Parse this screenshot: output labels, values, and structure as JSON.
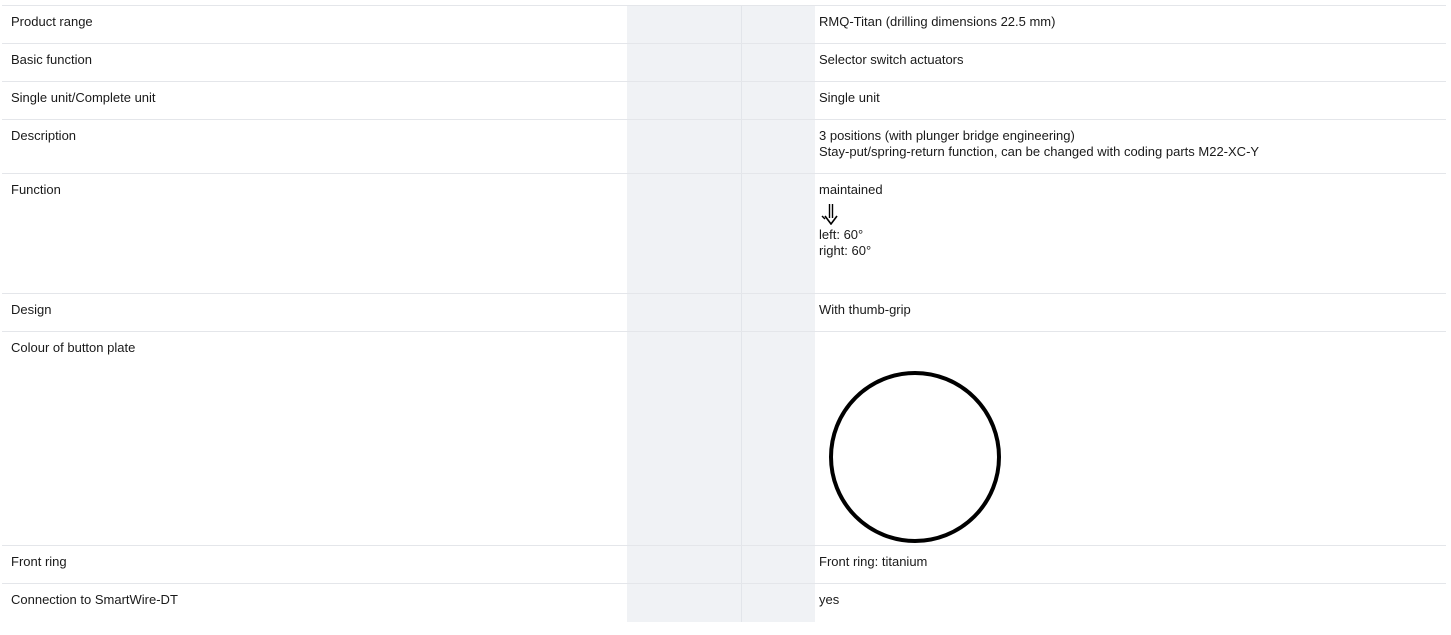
{
  "rows": [
    {
      "label": "Product range",
      "value": "RMQ-Titan (drilling dimensions 22.5 mm)"
    },
    {
      "label": "Basic function",
      "value": "Selector switch actuators"
    },
    {
      "label": "Single unit/Complete unit",
      "value": "Single unit"
    },
    {
      "label": "Description",
      "value_lines": [
        "3 positions (with plunger bridge engineering)",
        "Stay-put/spring-return function, can be changed with coding parts M22-XC-Y"
      ]
    },
    {
      "label": "Function",
      "value": "maintained",
      "icon": "maintained-function-arrow-icon",
      "extra_lines": [
        "left: 60°",
        "right: 60°"
      ]
    },
    {
      "label": "Design",
      "value": "With thumb-grip"
    },
    {
      "label": "Colour of button plate",
      "icon": "button-plate-circle-icon"
    },
    {
      "label": "Front ring",
      "value": "Front ring: titanium"
    },
    {
      "label": "Connection to SmartWire-DT",
      "value": "yes"
    }
  ],
  "colors": {
    "shaded_column": "#f0f2f5",
    "divider": "#e4e6ea",
    "text": "#1a1a1a",
    "plate_outline": "#000000"
  }
}
